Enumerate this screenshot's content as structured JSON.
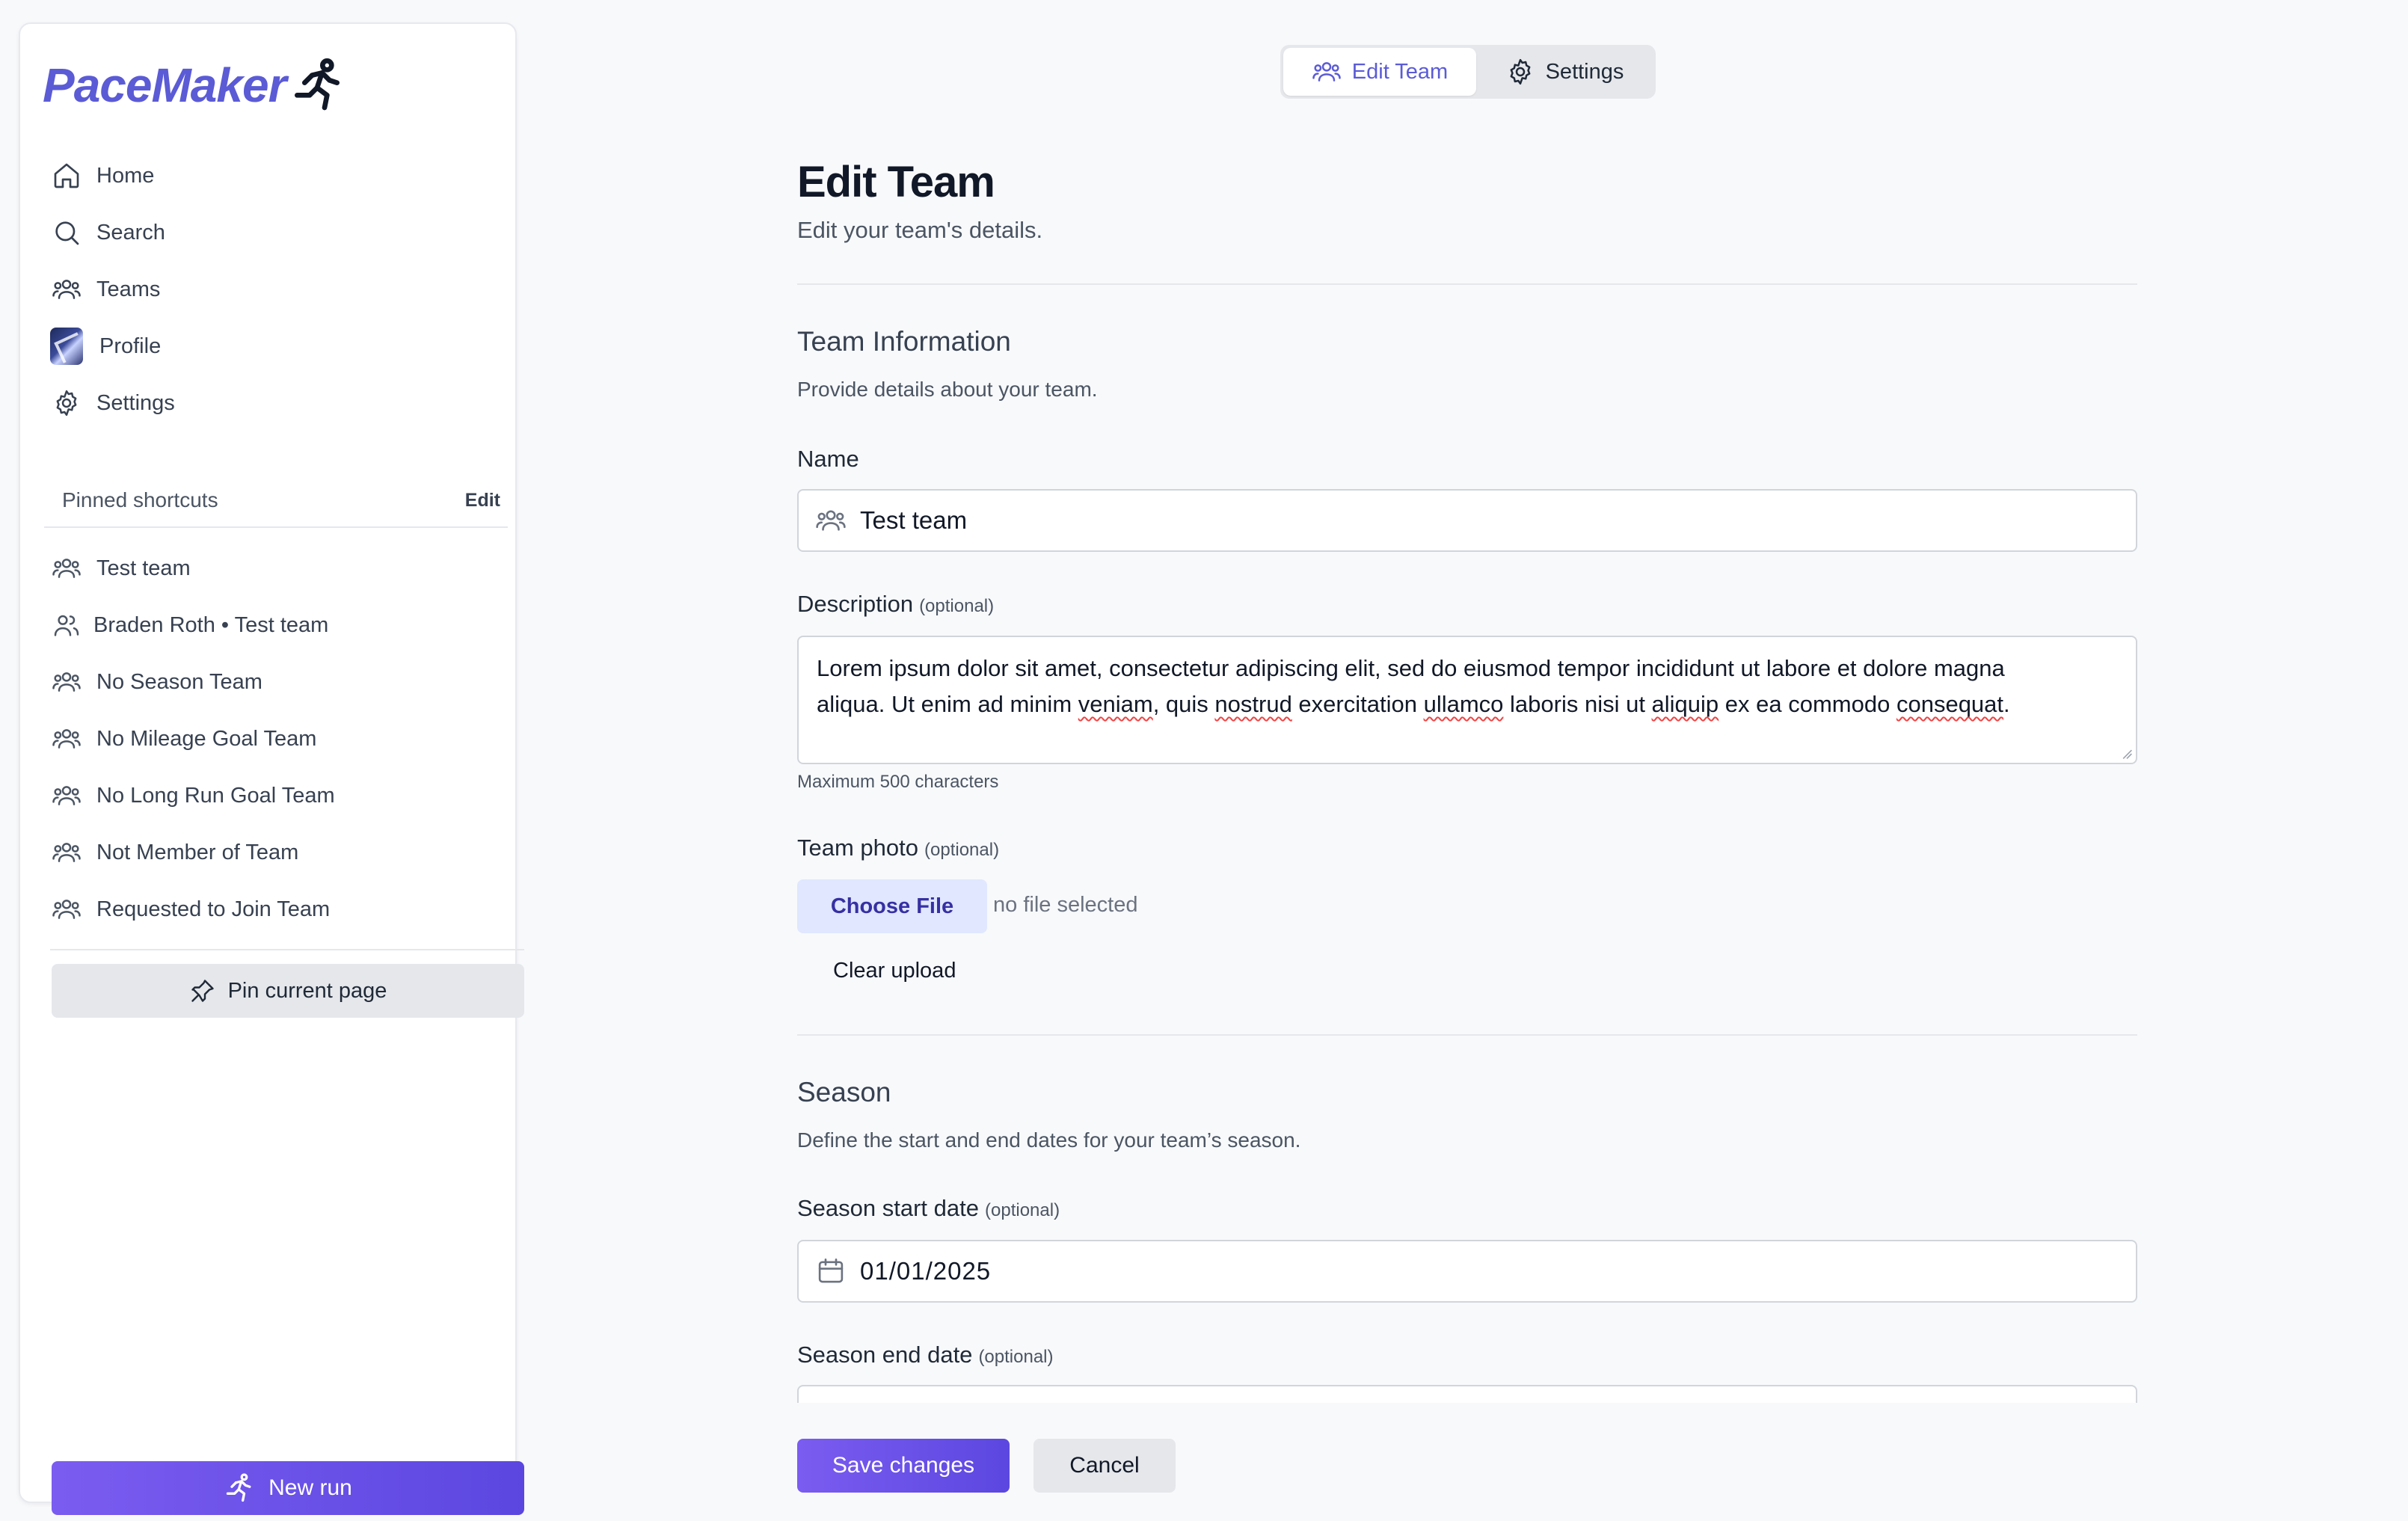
{
  "app": {
    "name": "PaceMaker"
  },
  "sidebar": {
    "nav": [
      {
        "label": "Home",
        "icon": "home-icon"
      },
      {
        "label": "Search",
        "icon": "search-icon"
      },
      {
        "label": "Teams",
        "icon": "users-icon"
      },
      {
        "label": "Profile",
        "icon": "avatar"
      },
      {
        "label": "Settings",
        "icon": "gear-icon"
      }
    ],
    "pinned_title": "Pinned shortcuts",
    "pinned_edit": "Edit",
    "pinned": [
      {
        "label": "Test team",
        "icon": "users-icon"
      },
      {
        "label": "Braden Roth • Test team",
        "icon": "user-pair-icon"
      },
      {
        "label": "No Season Team",
        "icon": "users-icon"
      },
      {
        "label": "No Mileage Goal Team",
        "icon": "users-icon"
      },
      {
        "label": "No Long Run Goal Team",
        "icon": "users-icon"
      },
      {
        "label": "Not Member of Team",
        "icon": "users-icon"
      },
      {
        "label": "Requested to Join Team",
        "icon": "users-icon"
      }
    ],
    "pin_current": "Pin current page",
    "new_run": "New run"
  },
  "tabs": [
    {
      "label": "Edit Team",
      "active": true
    },
    {
      "label": "Settings",
      "active": false
    }
  ],
  "page": {
    "title": "Edit Team",
    "subtitle": "Edit your team's details."
  },
  "team_info": {
    "title": "Team Information",
    "description": "Provide details about your team.",
    "name_label": "Name",
    "name_value": "Test team",
    "desc_label": "Description",
    "optional": "(optional)",
    "desc_line1": "Lorem ipsum dolor sit amet, consectetur adipiscing elit, sed do eiusmod tempor incididunt ut labore et dolore magna",
    "desc_line2": {
      "a": "aliqua. Ut enim ad minim ",
      "b": "veniam",
      "c": ", quis ",
      "d": "nostrud",
      "e": " exercitation ",
      "f": "ullamco",
      "g": " laboris nisi ut ",
      "h": "aliquip",
      "i": " ex ea commodo ",
      "j": "consequat",
      "k": "."
    },
    "desc_hint": "Maximum 500 characters",
    "photo_label": "Team photo",
    "choose_file": "Choose File",
    "file_status": "no file selected",
    "clear_upload": "Clear upload"
  },
  "season": {
    "title": "Season",
    "description": "Define the start and end dates for your team’s season.",
    "start_label": "Season start date",
    "start_value": "01/01/2025",
    "end_label": "Season end date",
    "optional": "(optional)"
  },
  "actions": {
    "save": "Save changes",
    "cancel": "Cancel"
  },
  "colors": {
    "accent": "#5b5bd6",
    "primary_gradient_start": "#7b5cf0",
    "primary_gradient_end": "#5b47e0",
    "file_button_bg": "#e0e7ff"
  }
}
